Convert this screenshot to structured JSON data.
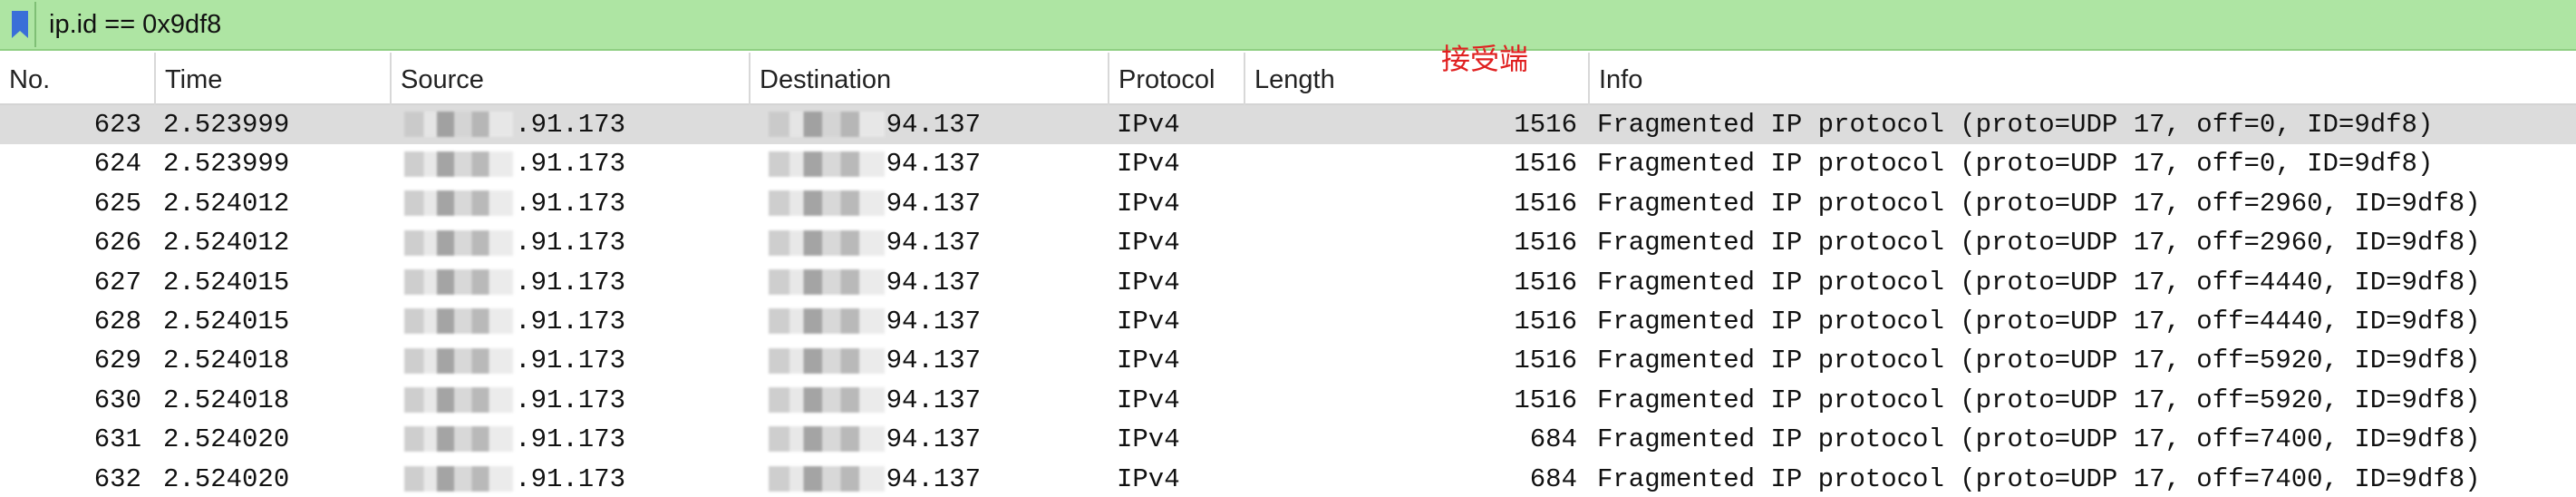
{
  "filter": {
    "value": "ip.id == 0x9df8",
    "bookmark_icon": "bookmark-icon"
  },
  "annotation": {
    "text": "接受端",
    "color": "#e02020"
  },
  "columns": [
    "No.",
    "Time",
    "Source",
    "Destination",
    "Protocol",
    "Length",
    "Info"
  ],
  "rows": [
    {
      "no": "623",
      "time": "2.523999",
      "source": ".91.173",
      "destination": "94.137",
      "protocol": "IPv4",
      "length": "1516",
      "info": "Fragmented IP protocol (proto=UDP 17, off=0, ID=9df8)",
      "selected": true
    },
    {
      "no": "624",
      "time": "2.523999",
      "source": ".91.173",
      "destination": "94.137",
      "protocol": "IPv4",
      "length": "1516",
      "info": "Fragmented IP protocol (proto=UDP 17, off=0, ID=9df8)"
    },
    {
      "no": "625",
      "time": "2.524012",
      "source": ".91.173",
      "destination": "94.137",
      "protocol": "IPv4",
      "length": "1516",
      "info": "Fragmented IP protocol (proto=UDP 17, off=2960, ID=9df8)"
    },
    {
      "no": "626",
      "time": "2.524012",
      "source": ".91.173",
      "destination": "94.137",
      "protocol": "IPv4",
      "length": "1516",
      "info": "Fragmented IP protocol (proto=UDP 17, off=2960, ID=9df8)"
    },
    {
      "no": "627",
      "time": "2.524015",
      "source": ".91.173",
      "destination": "94.137",
      "protocol": "IPv4",
      "length": "1516",
      "info": "Fragmented IP protocol (proto=UDP 17, off=4440, ID=9df8)"
    },
    {
      "no": "628",
      "time": "2.524015",
      "source": ".91.173",
      "destination": "94.137",
      "protocol": "IPv4",
      "length": "1516",
      "info": "Fragmented IP protocol (proto=UDP 17, off=4440, ID=9df8)"
    },
    {
      "no": "629",
      "time": "2.524018",
      "source": ".91.173",
      "destination": "94.137",
      "protocol": "IPv4",
      "length": "1516",
      "info": "Fragmented IP protocol (proto=UDP 17, off=5920, ID=9df8)"
    },
    {
      "no": "630",
      "time": "2.524018",
      "source": ".91.173",
      "destination": "94.137",
      "protocol": "IPv4",
      "length": "1516",
      "info": "Fragmented IP protocol (proto=UDP 17, off=5920, ID=9df8)"
    },
    {
      "no": "631",
      "time": "2.524020",
      "source": ".91.173",
      "destination": "94.137",
      "protocol": "IPv4",
      "length": "684",
      "info": "Fragmented IP protocol (proto=UDP 17, off=7400, ID=9df8)"
    },
    {
      "no": "632",
      "time": "2.524020",
      "source": ".91.173",
      "destination": "94.137",
      "protocol": "IPv4",
      "length": "684",
      "info": "Fragmented IP protocol (proto=UDP 17, off=7400, ID=9df8)"
    }
  ],
  "colors": {
    "filter_bg": "#aee5a3",
    "bookmark": "#3a6fd8",
    "selected_row": "#dcdcdc"
  }
}
